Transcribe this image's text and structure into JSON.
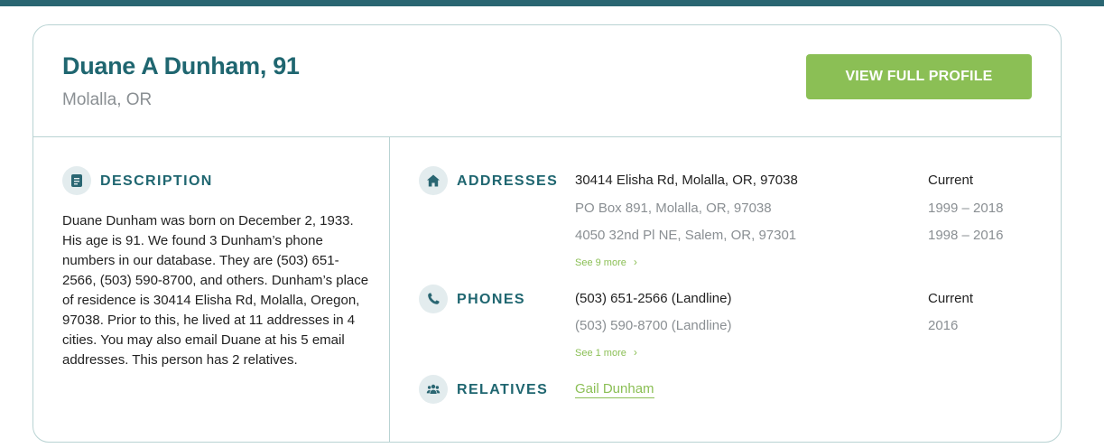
{
  "person": {
    "name": "Duane A Dunham, 91",
    "location": "Molalla, OR",
    "view_button": "VIEW FULL PROFILE"
  },
  "description": {
    "title": "DESCRIPTION",
    "text": "Duane Dunham was born on December 2, 1933. His age is 91. We found 3 Dunham’s phone numbers in our database. They are (503) 651-2566, (503) 590-8700, and others. Dunham’s place of residence is 30414 Elisha Rd, Molalla, Oregon, 97038. Prior to this, he lived at 11 addresses in 4 cities. You may also email Duane at his 5 email addresses. This person has 2 relatives."
  },
  "addresses": {
    "title": "ADDRESSES",
    "items": [
      {
        "address": "30414 Elisha Rd, Molalla, OR, 97038",
        "period": "Current"
      },
      {
        "address": "PO Box 891, Molalla, OR, 97038",
        "period": "1999 – 2018"
      },
      {
        "address": "4050 32nd Pl NE, Salem, OR, 97301",
        "period": "1998 – 2016"
      }
    ],
    "see_more": "See 9 more"
  },
  "phones": {
    "title": "PHONES",
    "items": [
      {
        "number": "(503) 651-2566 (Landline)",
        "period": "Current"
      },
      {
        "number": "(503) 590-8700 (Landline)",
        "period": "2016"
      }
    ],
    "see_more": "See 1 more"
  },
  "relatives": {
    "title": "RELATIVES",
    "items": [
      "Gail Dunham"
    ]
  },
  "colors": {
    "brand_teal": "#1f6670",
    "accent_green": "#8bbf55",
    "muted_text": "#8a8f93",
    "border": "#b9d3d3"
  },
  "icons": {
    "description": "document-icon",
    "addresses": "home-icon",
    "phones": "phone-icon",
    "relatives": "people-icon",
    "see_more": "chevron-right-icon"
  }
}
